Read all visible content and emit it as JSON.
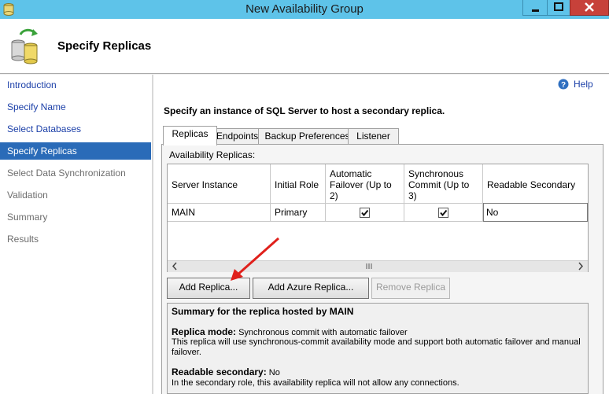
{
  "window": {
    "title": "New Availability Group"
  },
  "header": {
    "title": "Specify Replicas"
  },
  "nav": {
    "items": [
      {
        "label": "Introduction",
        "state": "link"
      },
      {
        "label": "Specify Name",
        "state": "link"
      },
      {
        "label": "Select Databases",
        "state": "link"
      },
      {
        "label": "Specify Replicas",
        "state": "active"
      },
      {
        "label": "Select Data Synchronization",
        "state": "disabled"
      },
      {
        "label": "Validation",
        "state": "disabled"
      },
      {
        "label": "Summary",
        "state": "disabled"
      },
      {
        "label": "Results",
        "state": "disabled"
      }
    ]
  },
  "help": {
    "label": "Help"
  },
  "instruction": "Specify an instance of SQL Server to host a secondary replica.",
  "tabs": [
    {
      "label": "Replicas",
      "active": true
    },
    {
      "label": "Endpoints",
      "active": false
    },
    {
      "label": "Backup Preferences",
      "active": false
    },
    {
      "label": "Listener",
      "active": false
    }
  ],
  "replicas": {
    "label": "Availability Replicas:",
    "columns": [
      "Server Instance",
      "Initial Role",
      "Automatic Failover (Up to 2)",
      "Synchronous Commit (Up to 3)",
      "Readable Secondary"
    ],
    "rows": [
      {
        "server": "MAIN",
        "role": "Primary",
        "auto_failover": true,
        "sync_commit": true,
        "readable": "No"
      }
    ]
  },
  "buttons": {
    "add_replica": "Add Replica...",
    "add_azure_replica": "Add Azure Replica...",
    "remove_replica": "Remove Replica"
  },
  "summary": {
    "title": "Summary for the replica hosted by MAIN",
    "mode_label": "Replica mode:",
    "mode_value": "Synchronous commit with automatic failover",
    "mode_desc_1": "This replica will use synchronous-commit availability mode and support both automatic failover and manual",
    "mode_desc_2": "failover.",
    "readable_label": "Readable secondary:",
    "readable_value": "No",
    "readable_desc": "In the secondary role, this availability replica will not allow any connections."
  },
  "colors": {
    "titlebar": "#5ec3e9",
    "nav_active": "#2a6bb8",
    "link": "#1b3fa8",
    "arrow": "#e0201b"
  }
}
